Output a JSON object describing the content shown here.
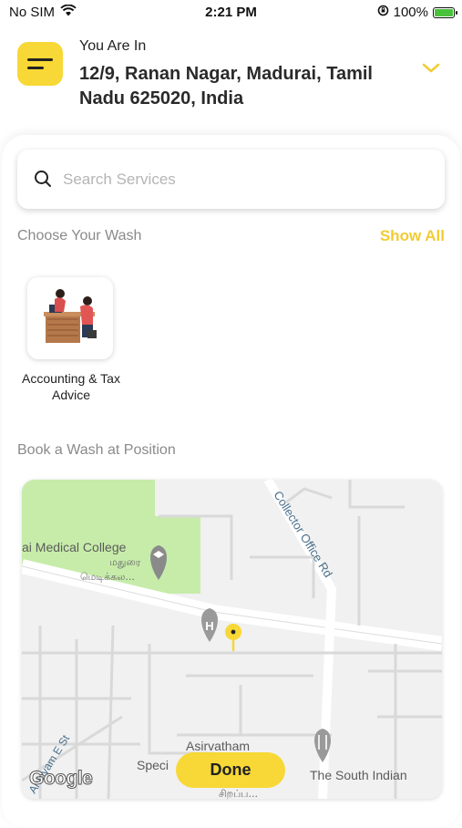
{
  "status": {
    "carrier": "No SIM",
    "time": "2:21 PM",
    "battery": "100%"
  },
  "header": {
    "label": "You Are In",
    "address": "12/9, Ranan Nagar, Madurai, Tamil Nadu 625020, India"
  },
  "search": {
    "placeholder": "Search Services"
  },
  "wash": {
    "title": "Choose Your Wash",
    "show_all": "Show All"
  },
  "services": [
    {
      "label": "Accounting & Tax Advice"
    }
  ],
  "position": {
    "title": "Book a Wash at Position"
  },
  "map": {
    "labels": {
      "college": "ai Medical College",
      "college_ta1": "மதுரை",
      "college_ta2": "மெடிக்கல...",
      "road": "Collector Office Rd",
      "street": "Anbiyam E St",
      "asirvatham": "Asirvatham",
      "speci": "Speci",
      "south_indian": "The South Indian",
      "tamil_bottom": "சிறப்ப..."
    },
    "logo": "Google"
  },
  "done_label": "Done",
  "colors": {
    "accent": "#f7d836",
    "show_all": "#f2cc32",
    "park": "#c7ecaa",
    "pin": "#f7d836"
  }
}
